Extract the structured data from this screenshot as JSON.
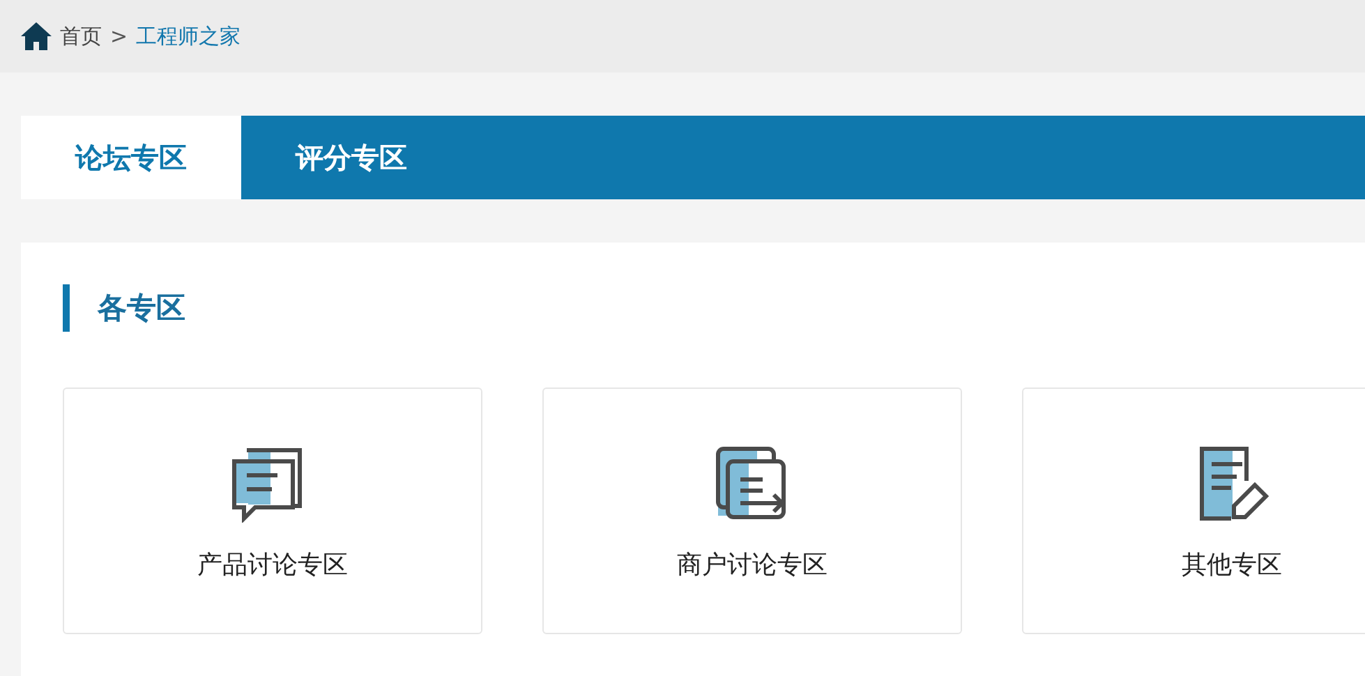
{
  "breadcrumb": {
    "home": "首页",
    "separator": ">",
    "current": "工程师之家"
  },
  "tabs": [
    {
      "label": "论坛专区",
      "selected": true
    },
    {
      "label": "评分专区",
      "selected": false
    }
  ],
  "section": {
    "title": "各专区"
  },
  "zones": [
    {
      "label": "产品讨论专区",
      "kind": "chat"
    },
    {
      "label": "商户讨论专区",
      "kind": "docs"
    },
    {
      "label": "其他专区",
      "kind": "note"
    }
  ]
}
